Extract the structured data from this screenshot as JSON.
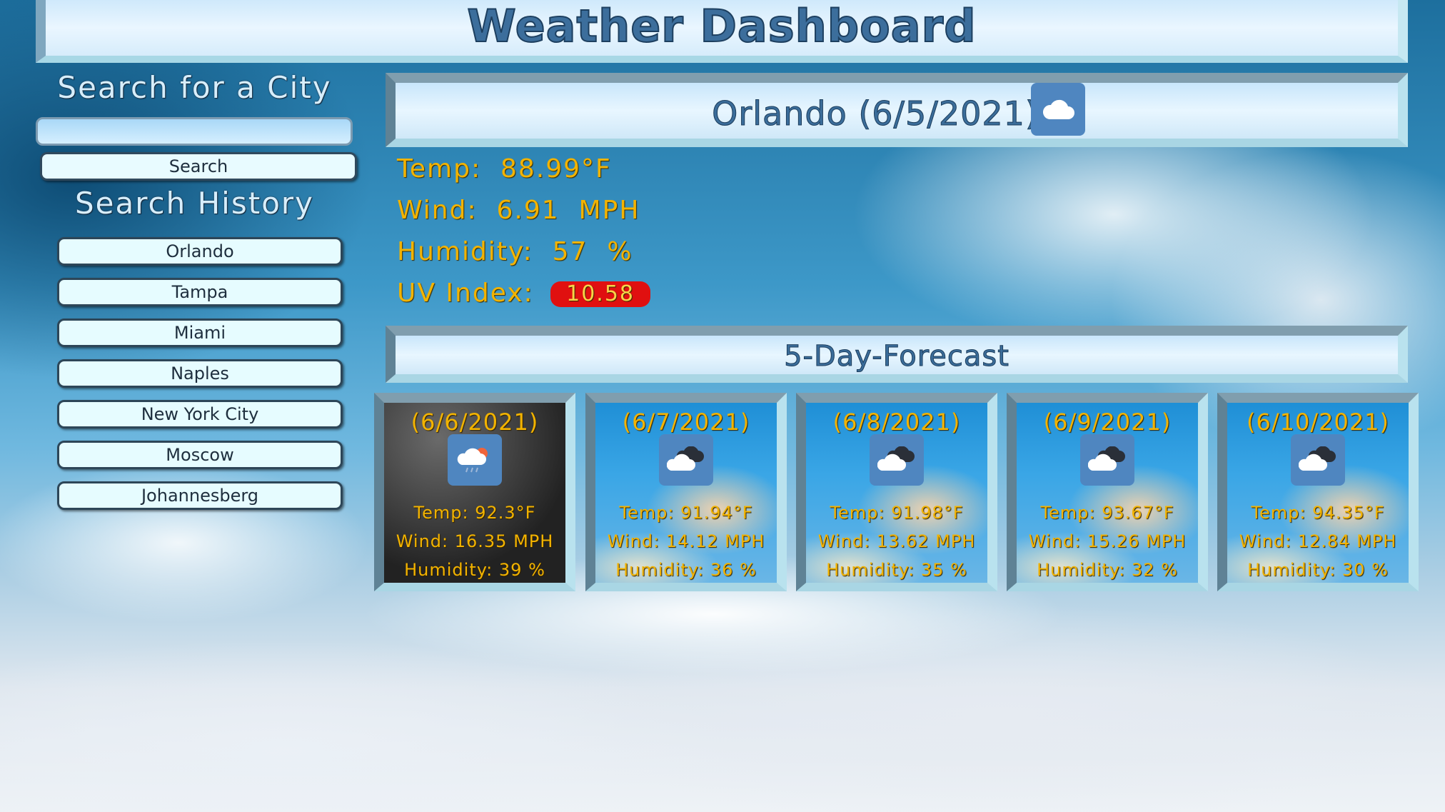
{
  "header": {
    "title": "Weather Dashboard"
  },
  "sidebar": {
    "search_heading": "Search for a City",
    "search_input": {
      "value": "",
      "placeholder": ""
    },
    "search_button": "Search",
    "history_heading": "Search History",
    "history": [
      "Orlando",
      "Tampa",
      "Miami",
      "Naples",
      "New York City",
      "Moscow",
      "Johannesberg"
    ]
  },
  "current": {
    "city_date": "Orlando (6/5/2021)",
    "icon": "cloud-icon",
    "temp_label": "Temp:",
    "temp_value": "88.99",
    "temp_unit": "°F",
    "wind_label": "Wind:",
    "wind_value": "6.91",
    "wind_unit": "MPH",
    "humidity_label": "Humidity:",
    "humidity_value": "57",
    "humidity_unit": "%",
    "uv_label": "UV Index:",
    "uv_value": "10.58"
  },
  "forecast": {
    "heading": "5-Day-Forecast",
    "days": [
      {
        "date": "(6/6/2021)",
        "icon": "rain-sun-icon",
        "temp": "Temp:  92.3°F",
        "wind": "Wind:  16.35  MPH",
        "humidity": "Humidity:  39  %"
      },
      {
        "date": "(6/7/2021)",
        "icon": "clouds-icon",
        "temp": "Temp:  91.94°F",
        "wind": "Wind:  14.12  MPH",
        "humidity": "Humidity:  36  %"
      },
      {
        "date": "(6/8/2021)",
        "icon": "clouds-icon",
        "temp": "Temp:  91.98°F",
        "wind": "Wind:  13.62  MPH",
        "humidity": "Humidity:  35  %"
      },
      {
        "date": "(6/9/2021)",
        "icon": "clouds-icon",
        "temp": "Temp:  93.67°F",
        "wind": "Wind:  15.26  MPH",
        "humidity": "Humidity:  32  %"
      },
      {
        "date": "(6/10/2021)",
        "icon": "clouds-icon",
        "temp": "Temp:  94.35°F",
        "wind": "Wind:  12.84  MPH",
        "humidity": "Humidity:  30  %"
      }
    ]
  },
  "colors": {
    "accent_text": "#f2b300",
    "uv_badge": "#e01010",
    "icon_bg": "#4f86c0"
  }
}
